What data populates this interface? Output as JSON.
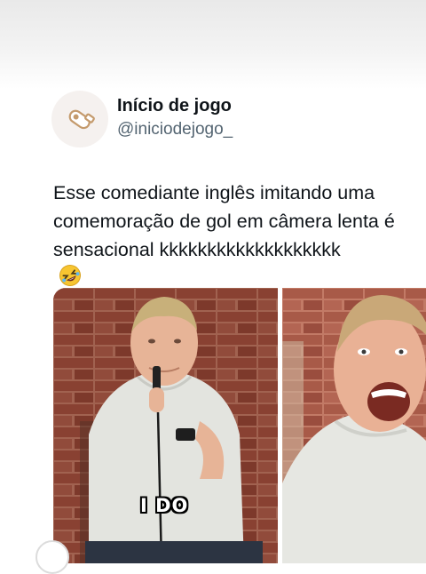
{
  "tweet": {
    "display_name": "Início de jogo",
    "handle": "@iniciodejogo_",
    "text_lines": [
      "Esse comediante inglês imitando uma",
      "comemoração de gol em câmera lenta é",
      "sensacional kkkkkkkkkkkkkkkkkkk"
    ],
    "emoji_name": "rolling-on-floor-laughing-emoji"
  },
  "media": {
    "left_caption": "I DO",
    "left_image_name": "comedian-holding-microphone-photo",
    "right_image_name": "comedian-shouting-closeup-photo"
  },
  "avatar": {
    "icon_name": "whistle-icon",
    "colors": {
      "background": "#f5f1ef",
      "icon": "#c49a6c"
    }
  }
}
